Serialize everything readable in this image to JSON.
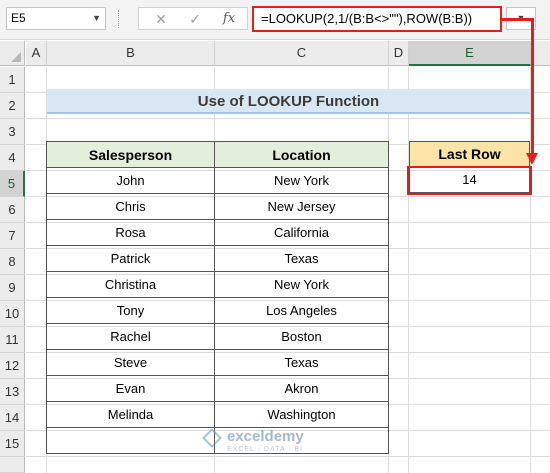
{
  "formula_bar": {
    "name_box": "E5",
    "cancel_symbol": "✕",
    "enter_symbol": "✓",
    "fx_symbol": "fx",
    "formula": "=LOOKUP(2,1/(B:B<>\"\"),ROW(B:B))",
    "dropdown_symbol": "▼",
    "expand_symbol": "▼"
  },
  "columns": [
    "A",
    "B",
    "C",
    "D",
    "E"
  ],
  "rows": [
    "1",
    "2",
    "3",
    "4",
    "5",
    "6",
    "7",
    "8",
    "9",
    "10",
    "11",
    "12",
    "13",
    "14",
    "15"
  ],
  "selected_cell": {
    "column": "E",
    "row": "5"
  },
  "sheet": {
    "title": "Use of LOOKUP Function",
    "table": {
      "headers": [
        "Salesperson",
        "Location"
      ],
      "rows": [
        [
          "John",
          "New York"
        ],
        [
          "Chris",
          "New Jersey"
        ],
        [
          "Rosa",
          "California"
        ],
        [
          "Patrick",
          "Texas"
        ],
        [
          "Christina",
          "New York"
        ],
        [
          "Tony",
          "Los Angeles"
        ],
        [
          "Rachel",
          "Boston"
        ],
        [
          "Steve",
          "Texas"
        ],
        [
          "Evan",
          "Akron"
        ],
        [
          "Melinda",
          "Washington"
        ],
        [
          "",
          ""
        ]
      ]
    },
    "last_row": {
      "header": "Last Row",
      "value": "14"
    }
  },
  "watermark": {
    "name": "exceldemy",
    "tagline": "EXCEL · DATA · BI"
  },
  "colors": {
    "title_fill": "#d9e7f4",
    "table_header_fill": "#e2efda",
    "last_row_header_fill": "#fce4a8",
    "highlight_red": "#e02020",
    "excel_green": "#217346"
  }
}
